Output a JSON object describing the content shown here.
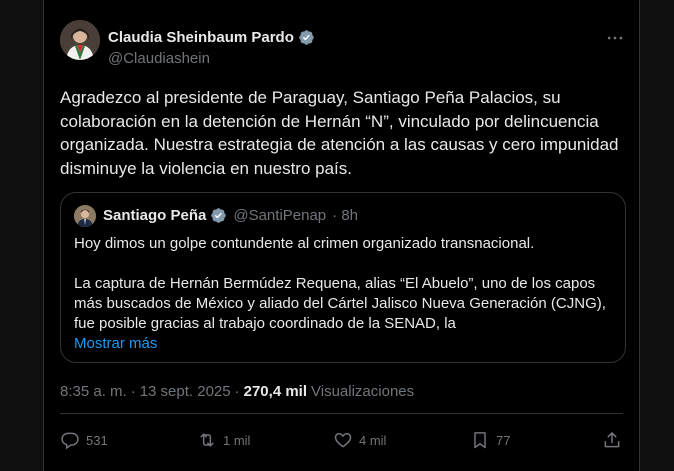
{
  "author": {
    "name": "Claudia Sheinbaum Pardo",
    "handle": "@Claudiashein"
  },
  "post": {
    "text": "Agradezco al presidente de Paraguay, Santiago Peña Palacios, su colaboración en la detención de Hernán “N”, vinculado por delincuencia organizada. Nuestra estrategia de atención a las causas y cero impunidad disminuye la violencia en nuestro país."
  },
  "quote": {
    "name": "Santiago Peña",
    "handle": "@SantiPenap",
    "time": "· 8h",
    "line1": "Hoy dimos un golpe contundente al crimen organizado transnacional.",
    "line2": "La captura de Hernán Bermúdez Requena, alias “El Abuelo”, uno de los capos más buscados de México y aliado del Cártel Jalisco Nueva Generación (CJNG), fue posible gracias al trabajo coordinado de la SENAD, la",
    "show_more": "Mostrar más"
  },
  "meta": {
    "time": "8:35 a. m.",
    "sep1": "·",
    "date": "13 sept. 2025",
    "sep2": "·",
    "views": "270,4 mil",
    "views_label": "Visualizaciones"
  },
  "actions": {
    "replies": "531",
    "reposts": "1 mil",
    "likes": "4 mil",
    "bookmarks": "77"
  },
  "colors": {
    "background": "#000000",
    "text": "#e7e9ea",
    "muted": "#71767b",
    "link": "#1d9bf0",
    "border": "#2f3336",
    "verified_badge": "#829aab"
  }
}
